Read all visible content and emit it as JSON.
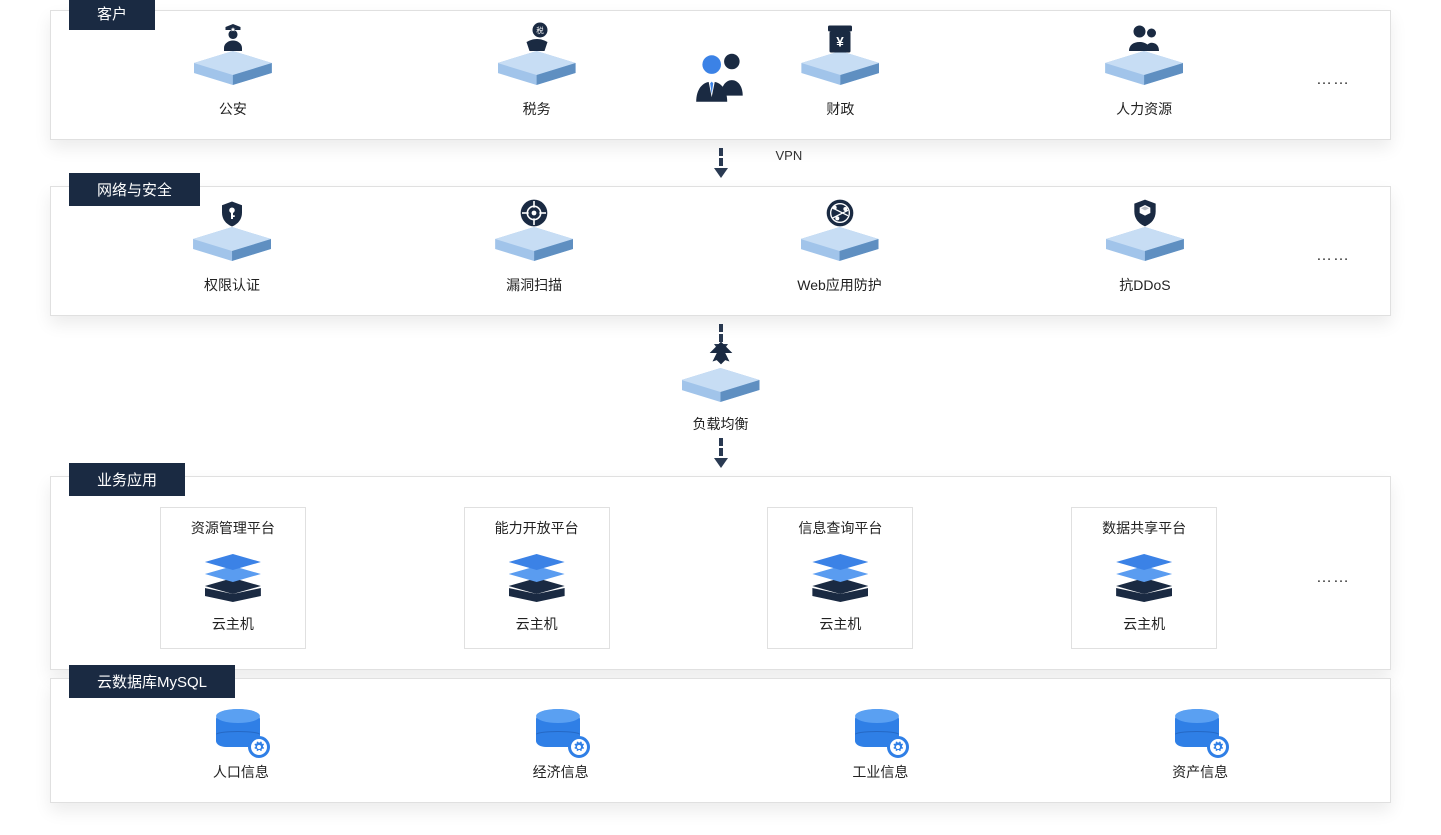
{
  "sections": {
    "customers": {
      "label": "客户",
      "items": [
        "公安",
        "税务",
        "财政",
        "人力资源"
      ],
      "ellipsis": "……"
    },
    "vpn_label": "VPN",
    "security": {
      "label": "网络与安全",
      "items": [
        "权限认证",
        "漏洞扫描",
        "Web应用防护",
        "抗DDoS"
      ],
      "ellipsis": "……"
    },
    "load_balance": "负载均衡",
    "apps": {
      "label": "业务应用",
      "boxes": [
        {
          "title": "资源管理平台",
          "sub": "云主机"
        },
        {
          "title": "能力开放平台",
          "sub": "云主机"
        },
        {
          "title": "信息查询平台",
          "sub": "云主机"
        },
        {
          "title": "数据共享平台",
          "sub": "云主机"
        }
      ],
      "ellipsis": "……"
    },
    "db": {
      "label": "云数据库MySQL",
      "items": [
        "人口信息",
        "经济信息",
        "工业信息",
        "资产信息"
      ]
    }
  }
}
